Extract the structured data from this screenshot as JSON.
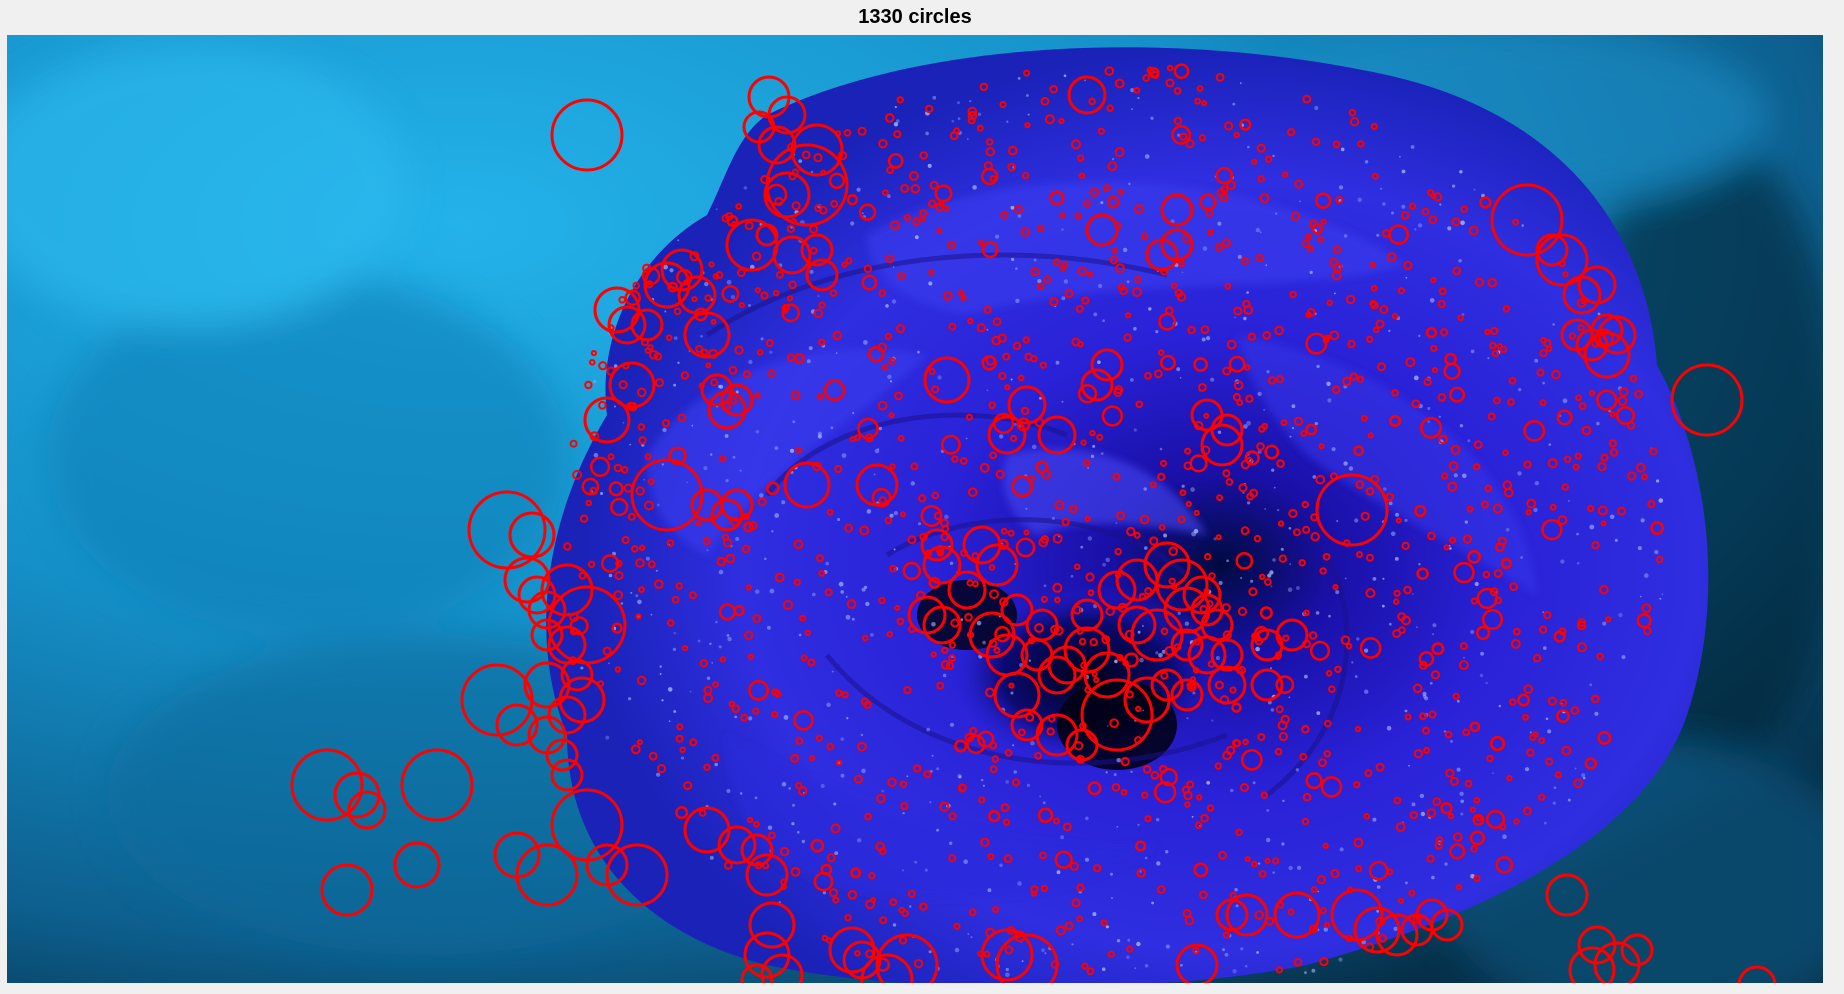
{
  "figure": {
    "title": "1330 circles"
  },
  "colors": {
    "circle_stroke": "#ff0000",
    "background_blue": "#1aa0d8",
    "rose_blue": "#2a1fd6"
  }
}
